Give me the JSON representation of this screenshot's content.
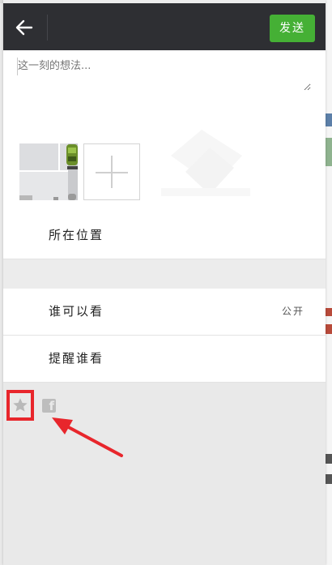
{
  "header": {
    "send_label": "发送",
    "back_icon": "arrow-left-icon"
  },
  "compose": {
    "placeholder": "这一刻的想法..."
  },
  "rows": {
    "location_label": "所在位置",
    "visibility_label": "谁可以看",
    "visibility_value": "公开",
    "remind_label": "提醒谁看"
  },
  "share_icons": [
    "star-icon",
    "facebook-icon"
  ],
  "colors": {
    "header_bg": "#2e2f33",
    "send_bg": "#45b035",
    "highlight": "#e8262c"
  }
}
